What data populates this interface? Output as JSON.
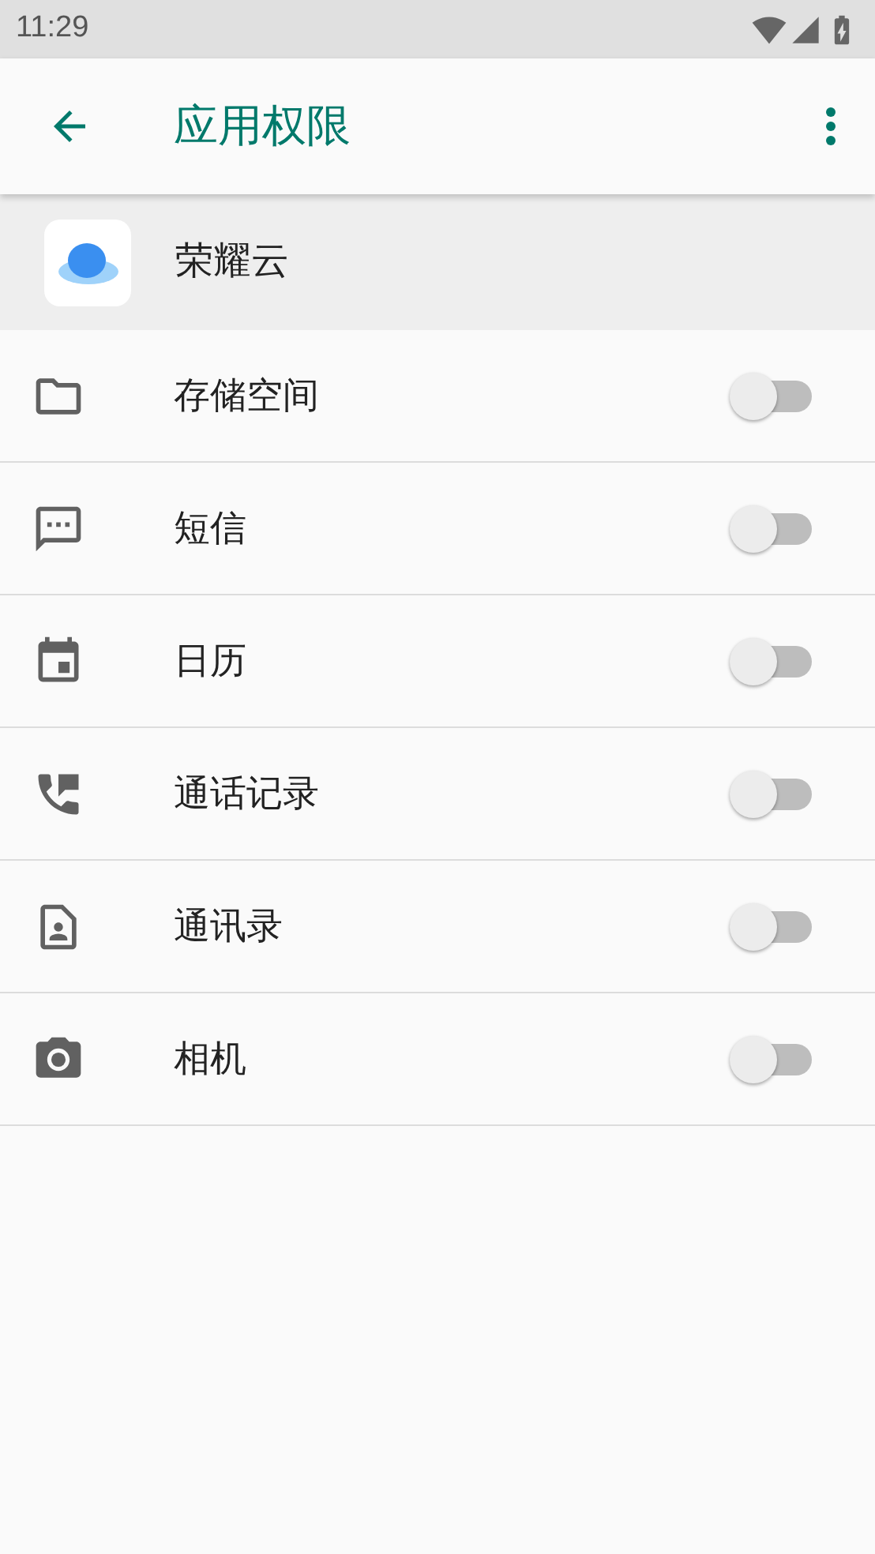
{
  "status_bar": {
    "time": "11:29"
  },
  "app_bar": {
    "title": "应用权限"
  },
  "app": {
    "name": "荣耀云"
  },
  "permissions": [
    {
      "label": "存储空间",
      "on": false
    },
    {
      "label": "短信",
      "on": false
    },
    {
      "label": "日历",
      "on": false
    },
    {
      "label": "通话记录",
      "on": false
    },
    {
      "label": "通讯录",
      "on": false
    },
    {
      "label": "相机",
      "on": false
    }
  ]
}
